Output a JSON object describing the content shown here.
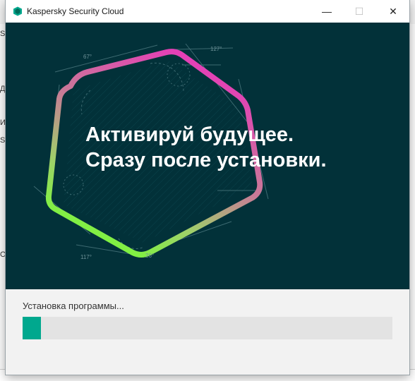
{
  "window": {
    "title": "Kaspersky Security Cloud"
  },
  "controls": {
    "minimize": "—",
    "maximize": "☐",
    "close": "✕"
  },
  "hero": {
    "headline_line1": "Активируй будущее.",
    "headline_line2": "Сразу после установки.",
    "angle_labels": [
      "67°",
      "127°",
      "117°",
      "26°"
    ],
    "background_color": "#023139",
    "gradient_colors": [
      "#e63cb8",
      "#c87a97",
      "#9fd06a",
      "#7cf53d"
    ]
  },
  "install": {
    "status_text": "Установка программы...",
    "progress_fraction": 0.05,
    "progress_color": "#00a88e"
  },
  "background_glyphs": [
    "Sa",
    "Ди",
    "Им",
    "Se",
    "Об"
  ]
}
